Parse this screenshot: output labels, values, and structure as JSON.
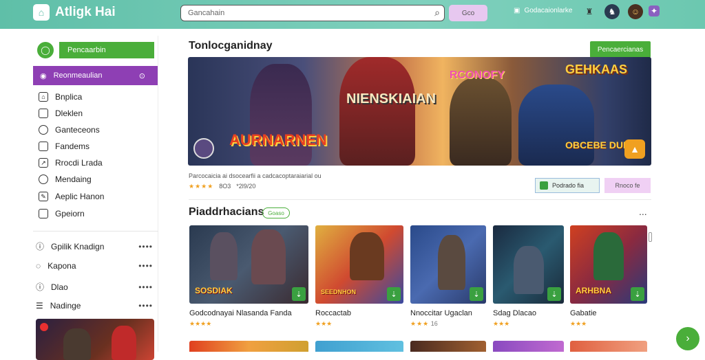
{
  "app": {
    "logo_text": "Atligk Hai"
  },
  "header": {
    "search_placeholder": "Gancahain",
    "search_button": "Gco",
    "download_label": "Godacaionlarke"
  },
  "sidebar": {
    "primary_button": "Pencaarbin",
    "active_item": "Reonmeaulian",
    "nav_items": [
      "Bnplica",
      "Dleklen",
      "Ganteceons",
      "Fandems",
      "Rrocdi Lrada",
      "Mendaing",
      "Aeplic Hanon",
      "Gpeiorn"
    ],
    "sections": [
      "Gpilik Knadign",
      "Kapona",
      "Dlao",
      "Nadinge"
    ]
  },
  "main": {
    "title": "Tonlocganidnay",
    "top_button": "Pencaercianas",
    "banner": {
      "title_left": "AURNARNEN",
      "title_center": "NIENSKIAIAN",
      "title_right_top": "RCONOFY",
      "title_right": "GEHKAAS",
      "title_bottom_right": "OBCEBE DUNAB"
    },
    "meta_line": "Parcocaicia ai dsocearfii a cadcacoptaraiarial ou",
    "rating_count": "8O3",
    "rating_extra": "*2l9/20",
    "button_a": "Podrado  fia",
    "button_b": "Rnoco fe",
    "section_title": "Piaddrhacians",
    "section_badge": "Goaso",
    "more": "...",
    "cards": [
      {
        "title": "Godcodnayai Nlasanda Fanda",
        "art": "SOSDIAK",
        "stars": "★★★★"
      },
      {
        "title": "Roccactab",
        "art": "SEEDNHON",
        "stars": "★★★"
      },
      {
        "title": "Nnoccitar Ugaclan",
        "art": "",
        "stars": "★★★",
        "extra": "16"
      },
      {
        "title": "Sdag Dlacao",
        "art": "",
        "stars": "★★★"
      },
      {
        "title": "Gabatie",
        "art": "ARHBNA",
        "stars": "★★★"
      }
    ]
  }
}
